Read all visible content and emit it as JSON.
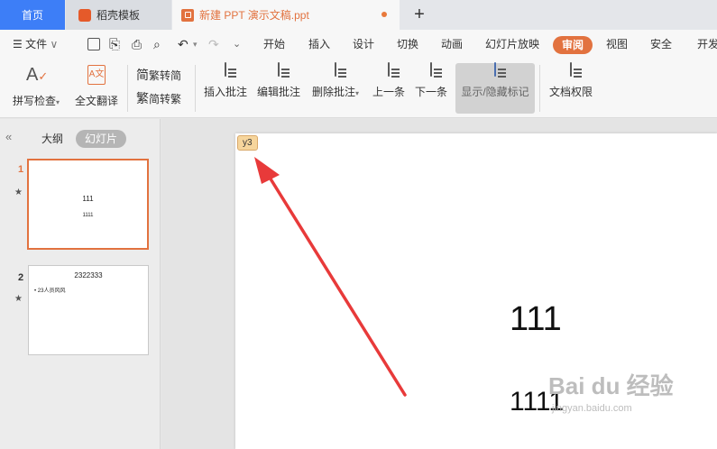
{
  "tabs": {
    "home": "首页",
    "template": "稻壳模板",
    "document": "新建 PPT 演示文稿.ppt"
  },
  "menu": {
    "file": "文件",
    "items": [
      "开始",
      "插入",
      "设计",
      "切换",
      "动画",
      "幻灯片放映",
      "审阅",
      "视图",
      "安全",
      "开发"
    ],
    "active": "审阅"
  },
  "ribbon": {
    "spell_check": "拼写检查",
    "translate": "全文翻译",
    "trad_to_simp": "繁转简",
    "simp_to_trad": "简转繁",
    "insert_comment": "插入批注",
    "edit_comment": "编辑批注",
    "delete_comment": "删除批注",
    "prev": "上一条",
    "next": "下一条",
    "show_hide": "显示/隐藏标记",
    "doc_rights": "文档权限"
  },
  "panel": {
    "outline": "大纲",
    "slides": "幻灯片",
    "thumbs": [
      {
        "num": "1",
        "title": "111",
        "sub": "1111"
      },
      {
        "num": "2",
        "title": "2322333",
        "bullet": "• 23人员风风"
      }
    ]
  },
  "slide": {
    "comment_marker": "y3",
    "title": "111",
    "subtitle": "1111"
  },
  "watermark": {
    "brand": "Bai du 经验",
    "url": "jingyan.baidu.com"
  },
  "colors": {
    "accent": "#e2723f",
    "home_tab": "#3d7ef7",
    "arrow": "#e83a3a"
  }
}
